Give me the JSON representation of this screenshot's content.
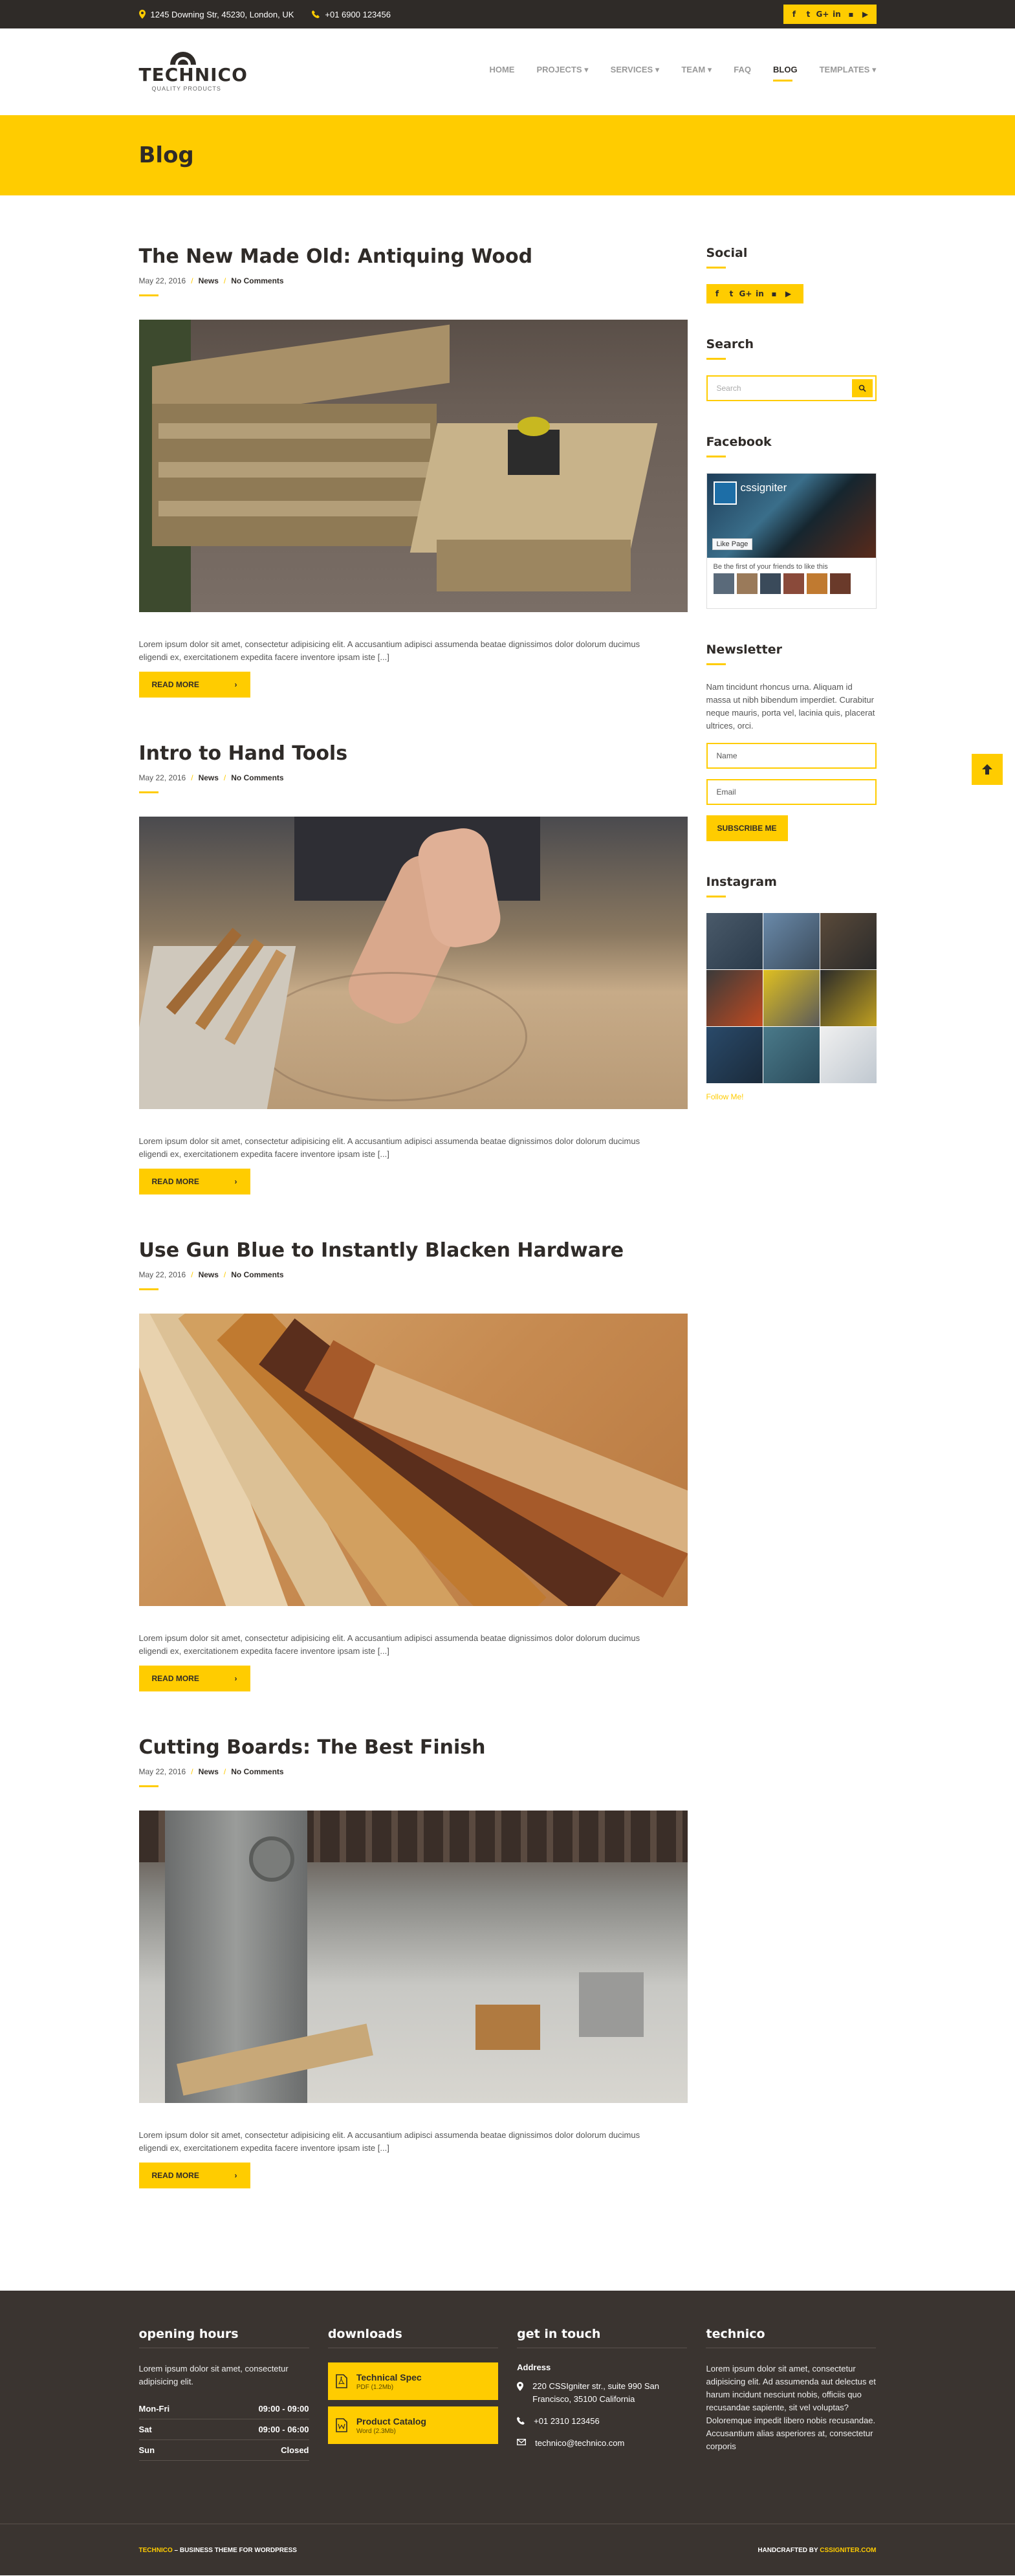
{
  "topbar": {
    "address": "1245 Downing Str, 45230, London, UK",
    "phone": "+01 6900 123456",
    "social_icons": [
      "facebook-icon",
      "twitter-icon",
      "google-plus-icon",
      "linkedin-icon",
      "flickr-icon",
      "youtube-icon"
    ]
  },
  "brand": {
    "name": "TECHNICO",
    "tagline": "QUALITY PRODUCTS",
    "accent": "#ffcc00",
    "dark": "#2f2b28"
  },
  "nav": {
    "home": "HOME",
    "projects": "PROJECTS",
    "services": "SERVICES",
    "team": "TEAM",
    "faq": "FAQ",
    "blog": "BLOG",
    "templates": "TEMPLATES"
  },
  "page": {
    "title": "Blog"
  },
  "posts": [
    {
      "title": "The New Made Old: Antiquing Wood",
      "date": "May 22, 2016",
      "category": "News",
      "comments": "No Comments",
      "excerpt": "Lorem ipsum dolor sit amet, consectetur adipisicing elit. A accusantium adipisci assumenda beatae dignissimos dolor dolorum ducimus eligendi ex, exercitationem expedita facere inventore ipsam iste [...]",
      "button": "READ MORE"
    },
    {
      "title": "Intro to Hand Tools",
      "date": "May 22, 2016",
      "category": "News",
      "comments": "No Comments",
      "excerpt": "Lorem ipsum dolor sit amet, consectetur adipisicing elit. A accusantium adipisci assumenda beatae dignissimos dolor dolorum ducimus eligendi ex, exercitationem expedita facere inventore ipsam iste [...]",
      "button": "READ MORE"
    },
    {
      "title": "Use Gun Blue to Instantly Blacken Hardware",
      "date": "May 22, 2016",
      "category": "News",
      "comments": "No Comments",
      "excerpt": "Lorem ipsum dolor sit amet, consectetur adipisicing elit. A accusantium adipisci assumenda beatae dignissimos dolor dolorum ducimus eligendi ex, exercitationem expedita facere inventore ipsam iste [...]",
      "button": "READ MORE"
    },
    {
      "title": "Cutting Boards: The Best Finish",
      "date": "May 22, 2016",
      "category": "News",
      "comments": "No Comments",
      "excerpt": "Lorem ipsum dolor sit amet, consectetur adipisicing elit. A accusantium adipisci assumenda beatae dignissimos dolor dolorum ducimus eligendi ex, exercitationem expedita facere inventore ipsam iste [...]",
      "button": "READ MORE"
    }
  ],
  "sidebar": {
    "social_title": "Social",
    "search_title": "Search",
    "search_placeholder": "Search",
    "facebook_title": "Facebook",
    "facebook_page": "cssigniter",
    "facebook_like": "Like Page",
    "facebook_friends": "Be the first of your friends to like this",
    "newsletter_title": "Newsletter",
    "newsletter_text": "Nam tincidunt rhoncus urna. Aliquam id massa ut nibh bibendum imperdiet. Curabitur neque mauris, porta vel, lacinia quis, placerat ultrices, orci.",
    "name_placeholder": "Name",
    "email_placeholder": "Email",
    "subscribe": "SUBSCRIBE ME",
    "instagram_title": "Instagram",
    "follow": "Follow Me!"
  },
  "footer": {
    "hours_title": "opening hours",
    "hours_text": "Lorem ipsum dolor sit amet, consectetur adipisicing elit.",
    "hours": [
      {
        "day": "Mon-Fri",
        "time": "09:00 - 09:00"
      },
      {
        "day": "Sat",
        "time": "09:00 - 06:00"
      },
      {
        "day": "Sun",
        "time": "Closed"
      }
    ],
    "downloads_title": "downloads",
    "downloads": [
      {
        "name": "Technical Spec",
        "meta": "PDF (1.2Mb)"
      },
      {
        "name": "Product Catalog",
        "meta": "Word (2.3Mb)"
      }
    ],
    "contact_title": "get in touch",
    "contact_label": "Address",
    "contact_address": "220 CSSIgniter str., suite 990 San Francisco, 35100 California",
    "contact_phone": "+01 2310 123456",
    "contact_email": "technico@technico.com",
    "about_title": "technico",
    "about_text": "Lorem ipsum dolor sit amet, consectetur adipisicing elit. Ad assumenda aut delectus et harum incidunt nesciunt nobis, officiis quo recusandae sapiente, sit vel voluptas? Doloremque impedit libero nobis recusandae. Accusantium alias asperiores at, consectetur corporis",
    "bottom_brand": "TECHNICO",
    "bottom_left": " – BUSINESS THEME FOR WORDPRESS",
    "bottom_right": "HANDCRAFTED BY ",
    "bottom_link": "CSSIGNITER.COM"
  }
}
